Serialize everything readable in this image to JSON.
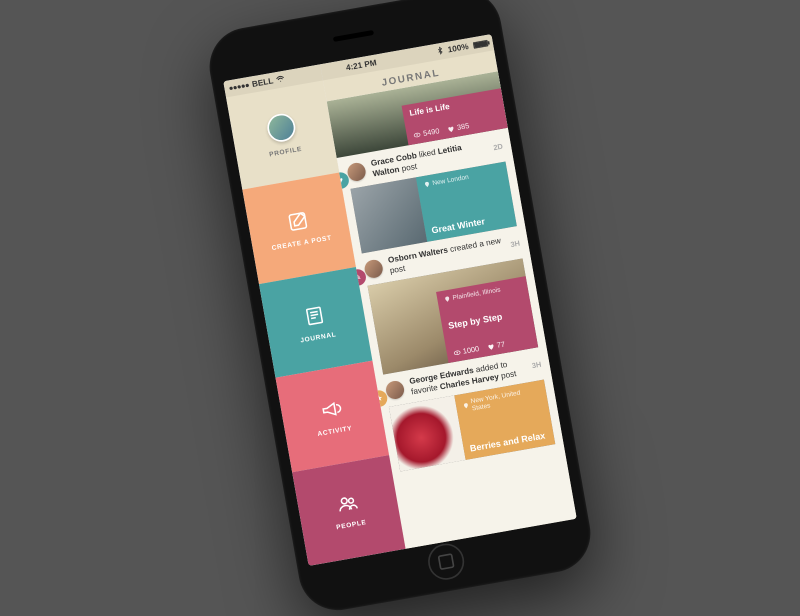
{
  "status": {
    "carrier": "BELL",
    "time": "4:21 PM",
    "battery": "100%"
  },
  "menu": {
    "profile": "Profile",
    "create": "Create a Post",
    "journal": "Journal",
    "activity": "Activity",
    "people": "People"
  },
  "main": {
    "title": "Journal"
  },
  "hero": {
    "title": "Life is Life",
    "views": "5490",
    "likes": "385"
  },
  "feed": [
    {
      "badge": "teal",
      "actor": "Grace Cobb",
      "verb": "liked",
      "target": "Letitia Walton",
      "suffix": "post",
      "time": "2D",
      "card": {
        "panel": "teal",
        "location": "New London",
        "title": "Great Winter",
        "views": "",
        "likes": ""
      }
    },
    {
      "badge": "rose",
      "actor": "Osborn Walters",
      "verb": "created a new post",
      "target": "",
      "suffix": "",
      "time": "3H",
      "card": {
        "panel": "rose",
        "location": "Plainfield, Illinois",
        "title": "Step by Step",
        "views": "1000",
        "likes": "77",
        "img": "steps",
        "tall": true
      }
    },
    {
      "badge": "gold",
      "actor": "George Edwards",
      "verb": "added to favorite",
      "target": "Charles Harvey",
      "suffix": "post",
      "time": "3H",
      "card": {
        "panel": "gold",
        "location": "New York, United States",
        "title": "Berries and Relax",
        "views": "",
        "likes": "",
        "img": "berries"
      }
    }
  ],
  "colors": {
    "orange": "#f5a97a",
    "teal": "#4aa3a3",
    "rose": "#e76d7a",
    "wine": "#b34a6d",
    "gold": "#e5a95a",
    "cream": "#e8e0c8"
  }
}
